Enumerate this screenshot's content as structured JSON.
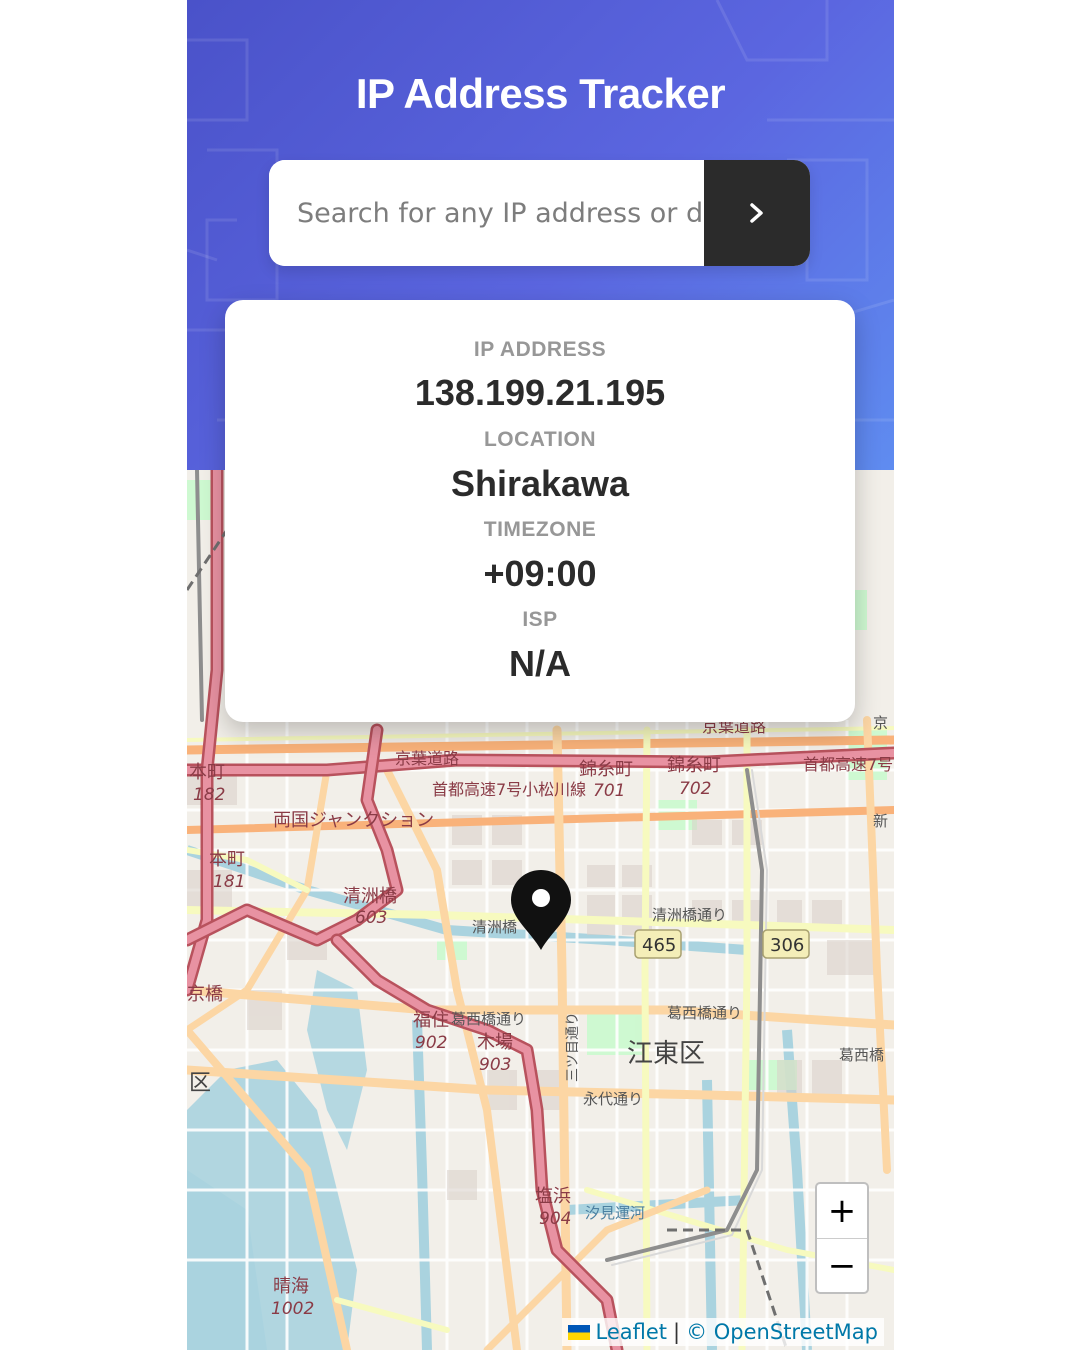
{
  "header": {
    "title": "IP Address Tracker"
  },
  "search": {
    "placeholder": "Search for any IP address or domain",
    "value": ""
  },
  "info": {
    "ip_label": "IP ADDRESS",
    "ip_value": "138.199.21.195",
    "location_label": "LOCATION",
    "location_value": "Shirakawa",
    "timezone_label": "TIMEZONE",
    "timezone_value": "+09:00",
    "isp_label": "ISP",
    "isp_value": "N/A"
  },
  "map": {
    "labels": {
      "keiyo": "京葉道路",
      "keiyo2": "京葉道路",
      "shuto7": "首都高速7号小松川線",
      "shuto7b": "首都高速7号",
      "kinshicho1": "錦糸町",
      "r701": "701",
      "kinshicho2": "錦糸町",
      "r702": "702",
      "honmachi1": "本町",
      "r182": "182",
      "ryogoku": "両国ジャンクション",
      "honmachi2": "本町",
      "r181": "181",
      "kiyosubashi": "清洲橋",
      "r603": "603",
      "kiyosubashi_dori": "清洲橋通り",
      "kiyosu2": "清洲橋",
      "r465": "465",
      "r306": "306",
      "fukuzumi": "福住",
      "kasai1": "葛西橋通り",
      "kasai2": "葛西橋通り",
      "kiba": "木場",
      "r902": "902",
      "r903": "903",
      "mitsume": "三ツ目通り",
      "koto": "江東区",
      "eitai": "永代通り",
      "shiohama": "塩浜",
      "r904": "904",
      "harumi": "晴海",
      "r1002": "1002",
      "ku": "区",
      "kyobashi": "京橋",
      "shin": "新",
      "kyo": "京",
      "shiomi": "汐見運河",
      "kasai3": "葛西橋"
    },
    "marker_icon": "location-pin-icon"
  },
  "zoom": {
    "in_label": "+",
    "out_label": "−"
  },
  "attribution": {
    "leaflet": "Leaflet",
    "separator": "|",
    "osm": "© OpenStreetMap"
  }
}
